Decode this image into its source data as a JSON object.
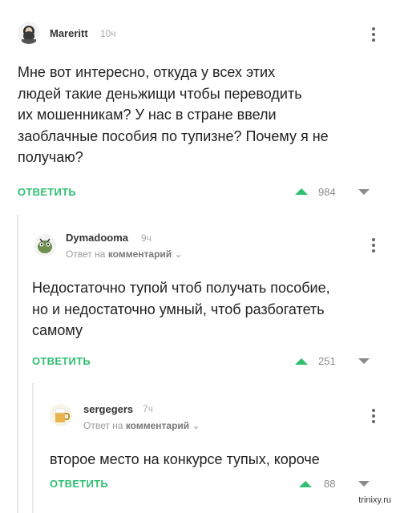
{
  "comments": [
    {
      "username": "Mareritt",
      "time": "10ч",
      "lines": [
        "Мне вот интересно, откуда у всех этих",
        "людей такие деньжищи чтобы переводить",
        "их мошенникам? У нас в стране ввели",
        "заоблачные пособия по тупизне? Почему я не",
        "получаю?"
      ],
      "reply_label": "ОТВЕТИТЬ",
      "rating": "984",
      "avatar_icon": "bearded-man-avatar-icon"
    },
    {
      "username": "Dymadooma",
      "time": "9ч",
      "reply_prefix": "Ответ на",
      "reply_target": "комментарий",
      "lines": [
        "Недостаточно тупой чтоб получать пособие,",
        "но и недостаточно умный, чтоб разбогатеть",
        "самому"
      ],
      "reply_label": "ОТВЕТИТЬ",
      "rating": "251",
      "avatar_icon": "green-creature-avatar-icon"
    },
    {
      "username": "sergegers",
      "time": "7ч",
      "reply_prefix": "Ответ на",
      "reply_target": "комментарий",
      "lines": [
        "второе место на конкурсе тупых, короче"
      ],
      "reply_label": "ОТВЕТИТЬ",
      "rating": "88",
      "avatar_icon": "beer-mug-avatar-icon"
    }
  ],
  "watermark": "trinixy.ru",
  "colors": {
    "accent": "#2fbf71",
    "muted": "#9a9a9a",
    "text": "#222222"
  }
}
